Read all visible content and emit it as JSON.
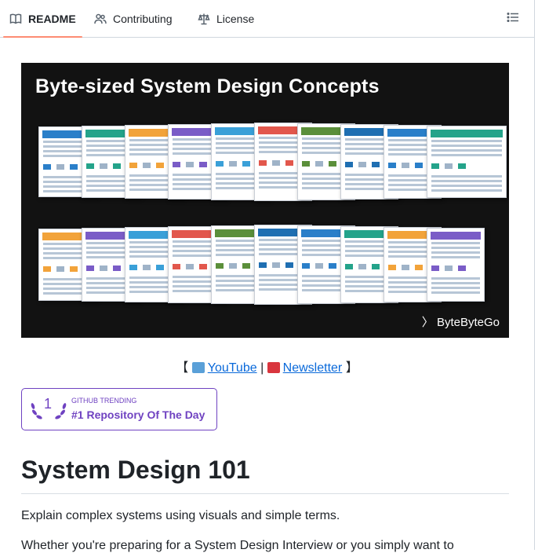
{
  "tabs": [
    {
      "label": "README",
      "icon": "book-icon",
      "active": true
    },
    {
      "label": "Contributing",
      "icon": "people-icon",
      "active": false
    },
    {
      "label": "License",
      "icon": "law-icon",
      "active": false
    }
  ],
  "outline_icon": "list-unordered-icon",
  "banner": {
    "title": "Byte-sized System Design Concepts",
    "logo": "ByteByteGo"
  },
  "links": {
    "open": "【",
    "youtube": "YouTube",
    "separator": "|",
    "newsletter": "Newsletter",
    "close": "】"
  },
  "trending": {
    "rank": "1",
    "kicker": "GITHUB TRENDING",
    "text": "#1 Repository Of The Day",
    "color": "#6f42c1"
  },
  "content": {
    "heading": "System Design 101",
    "intro": "Explain complex systems using visuals and simple terms.",
    "cutoff": "Whether you're preparing for a System Design Interview or you simply want to"
  }
}
